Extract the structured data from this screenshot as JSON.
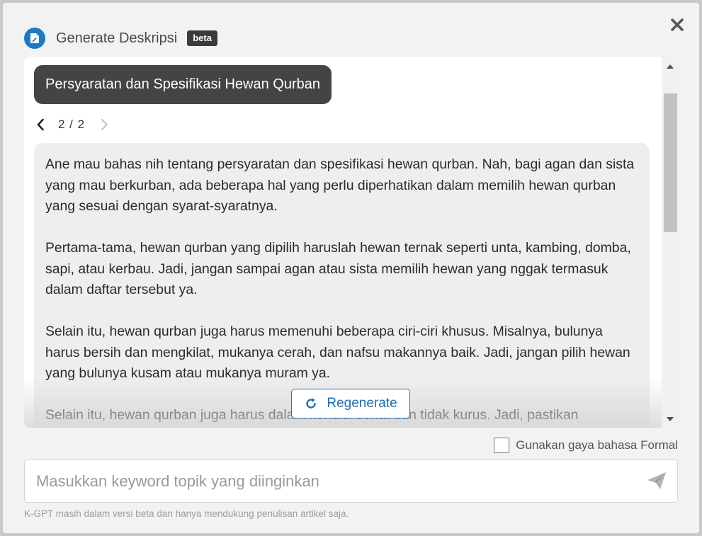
{
  "header": {
    "title": "Generate Deskripsi",
    "badge": "beta",
    "icon": "document-icon",
    "close_icon": "close-icon"
  },
  "result": {
    "topic": "Persyaratan dan Spesifikasi Hewan Qurban",
    "pager": "2 / 2",
    "paragraphs": [
      "Ane mau bahas nih tentang persyaratan dan spesifikasi hewan qurban. Nah, bagi agan dan sista yang mau berkurban, ada beberapa hal yang perlu diperhatikan dalam memilih hewan qurban yang sesuai dengan syarat-syaratnya.",
      "Pertama-tama, hewan qurban yang dipilih haruslah hewan ternak seperti unta, kambing, domba, sapi, atau kerbau. Jadi, jangan sampai agan atau sista memilih hewan yang nggak termasuk dalam daftar tersebut ya.",
      "Selain itu, hewan qurban juga harus memenuhi beberapa ciri-ciri khusus. Misalnya, bulunya harus bersih dan mengkilat, mukanya cerah, dan nafsu makannya baik. Jadi, jangan pilih hewan yang bulunya kusam atau mukanya muram ya.",
      "Selain itu, hewan qurban juga harus dalam kondisi sehat dan tidak kurus. Jadi, pastikan"
    ],
    "regenerate_label": "Regenerate"
  },
  "options": {
    "formal_label": "Gunakan gaya bahasa Formal",
    "formal_checked": false
  },
  "input": {
    "placeholder": "Masukkan keyword topik yang diinginkan",
    "value": ""
  },
  "footer": {
    "note": "K-GPT masih dalam versi beta dan hanya mendukung penulisan artikel saja."
  },
  "colors": {
    "accent": "#1e78c8",
    "chip_bg": "#444444",
    "modal_bg": "#f2f2f2"
  }
}
